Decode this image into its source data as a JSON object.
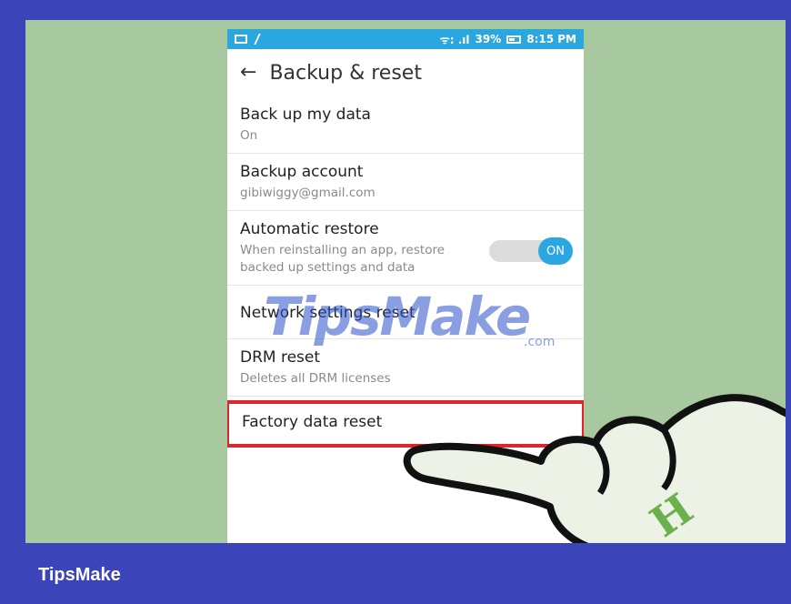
{
  "status_bar": {
    "signal": "ᯤ: .ıl",
    "battery_percent": "39%",
    "time": "8:15 PM"
  },
  "header": {
    "title": "Backup & reset"
  },
  "settings": {
    "back_up_data": {
      "title": "Back up my data",
      "subtitle": "On"
    },
    "backup_account": {
      "title": "Backup account",
      "subtitle": "gibiwiggy@gmail.com"
    },
    "automatic_restore": {
      "title": "Automatic restore",
      "subtitle": "When reinstalling an app, restore backed up settings and data",
      "toggle_label": "ON"
    },
    "network_reset": {
      "title": "Network settings reset"
    },
    "drm_reset": {
      "title": "DRM reset",
      "subtitle": "Deletes all DRM licenses"
    },
    "factory_reset": {
      "title": "Factory data reset"
    }
  },
  "watermark": {
    "text": "TipsMake",
    "suffix": ".com"
  },
  "footer": {
    "brand": "TipsMake"
  },
  "colors": {
    "frame": "#3b44b8",
    "background": "#a8c9a0",
    "status_bar": "#2aa7e0",
    "highlight": "#e2232a",
    "toggle_on": "#2aa7e0"
  }
}
